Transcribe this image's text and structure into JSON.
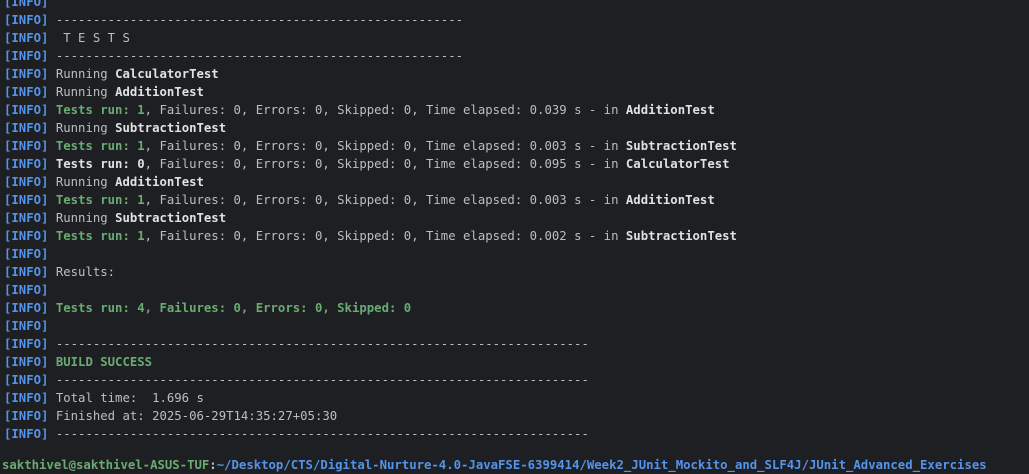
{
  "terminal": {
    "lines": [
      {
        "tag": "[INFO]",
        "segments": []
      },
      {
        "tag": "[INFO]",
        "segments": [
          {
            "t": " -------------------------------------------------------",
            "c": "default",
            "b": false
          }
        ]
      },
      {
        "tag": "[INFO]",
        "segments": [
          {
            "t": "  T E S T S",
            "c": "default",
            "b": false
          }
        ]
      },
      {
        "tag": "[INFO]",
        "segments": [
          {
            "t": " -------------------------------------------------------",
            "c": "default",
            "b": false
          }
        ]
      },
      {
        "tag": "[INFO]",
        "segments": [
          {
            "t": " Running ",
            "c": "default",
            "b": false
          },
          {
            "t": "CalculatorTest",
            "c": "white",
            "b": true
          }
        ]
      },
      {
        "tag": "[INFO]",
        "segments": [
          {
            "t": " Running ",
            "c": "default",
            "b": false
          },
          {
            "t": "AdditionTest",
            "c": "white",
            "b": true
          }
        ]
      },
      {
        "tag": "[INFO]",
        "segments": [
          {
            "t": " Tests run: 1",
            "c": "green",
            "b": true
          },
          {
            "t": ", Failures: 0, Errors: 0, Skipped: 0, Time elapsed: 0.039 s - in ",
            "c": "default",
            "b": false
          },
          {
            "t": "AdditionTest",
            "c": "white",
            "b": true
          }
        ]
      },
      {
        "tag": "[INFO]",
        "segments": [
          {
            "t": " Running ",
            "c": "default",
            "b": false
          },
          {
            "t": "SubtractionTest",
            "c": "white",
            "b": true
          }
        ]
      },
      {
        "tag": "[INFO]",
        "segments": [
          {
            "t": " Tests run: 1",
            "c": "green",
            "b": true
          },
          {
            "t": ", Failures: 0, Errors: 0, Skipped: 0, Time elapsed: 0.003 s - in ",
            "c": "default",
            "b": false
          },
          {
            "t": "SubtractionTest",
            "c": "white",
            "b": true
          }
        ]
      },
      {
        "tag": "[INFO]",
        "segments": [
          {
            "t": " Tests run: 0",
            "c": "white",
            "b": true
          },
          {
            "t": ", Failures: 0, Errors: 0, Skipped: 0, Time elapsed: 0.095 s - in ",
            "c": "default",
            "b": false
          },
          {
            "t": "CalculatorTest",
            "c": "white",
            "b": true
          }
        ]
      },
      {
        "tag": "[INFO]",
        "segments": [
          {
            "t": " Running ",
            "c": "default",
            "b": false
          },
          {
            "t": "AdditionTest",
            "c": "white",
            "b": true
          }
        ]
      },
      {
        "tag": "[INFO]",
        "segments": [
          {
            "t": " Tests run: 1",
            "c": "green",
            "b": true
          },
          {
            "t": ", Failures: 0, Errors: 0, Skipped: 0, Time elapsed: 0.003 s - in ",
            "c": "default",
            "b": false
          },
          {
            "t": "AdditionTest",
            "c": "white",
            "b": true
          }
        ]
      },
      {
        "tag": "[INFO]",
        "segments": [
          {
            "t": " Running ",
            "c": "default",
            "b": false
          },
          {
            "t": "SubtractionTest",
            "c": "white",
            "b": true
          }
        ]
      },
      {
        "tag": "[INFO]",
        "segments": [
          {
            "t": " Tests run: 1",
            "c": "green",
            "b": true
          },
          {
            "t": ", Failures: 0, Errors: 0, Skipped: 0, Time elapsed: 0.002 s - in ",
            "c": "default",
            "b": false
          },
          {
            "t": "SubtractionTest",
            "c": "white",
            "b": true
          }
        ]
      },
      {
        "tag": "[INFO]",
        "segments": []
      },
      {
        "tag": "[INFO]",
        "segments": [
          {
            "t": " Results:",
            "c": "default",
            "b": false
          }
        ]
      },
      {
        "tag": "[INFO]",
        "segments": []
      },
      {
        "tag": "[INFO]",
        "segments": [
          {
            "t": " Tests run: 4, Failures: 0, Errors: 0, Skipped: 0",
            "c": "green",
            "b": true
          }
        ]
      },
      {
        "tag": "[INFO]",
        "segments": []
      },
      {
        "tag": "[INFO]",
        "segments": [
          {
            "t": " ------------------------------------------------------------------------",
            "c": "default",
            "b": false
          }
        ]
      },
      {
        "tag": "[INFO]",
        "segments": [
          {
            "t": " BUILD SUCCESS",
            "c": "green",
            "b": true
          }
        ]
      },
      {
        "tag": "[INFO]",
        "segments": [
          {
            "t": " ------------------------------------------------------------------------",
            "c": "default",
            "b": false
          }
        ]
      },
      {
        "tag": "[INFO]",
        "segments": [
          {
            "t": " Total time:  1.696 s",
            "c": "default",
            "b": false
          }
        ]
      },
      {
        "tag": "[INFO]",
        "segments": [
          {
            "t": " Finished at: 2025-06-29T14:35:27+05:30",
            "c": "default",
            "b": false
          }
        ]
      },
      {
        "tag": "[INFO]",
        "segments": [
          {
            "t": " ------------------------------------------------------------------------",
            "c": "default",
            "b": false
          }
        ]
      }
    ]
  },
  "prompt": {
    "user_host": "sakthivel@sakthivel-ASUS-TUF",
    "separator": ":",
    "path": "~/Desktop/CTS/Digital-Nurture-4.0-JavaFSE-6399414/Week2_JUnit_Mockito_and_SLF4J/JUnit_Advanced_Exercises"
  },
  "colors": {
    "background": "#1e1f22",
    "info_tag": "#5394ec",
    "success_green": "#6aab73",
    "default_text": "#bcbec4",
    "emphasis_text": "#dfe1e5"
  }
}
